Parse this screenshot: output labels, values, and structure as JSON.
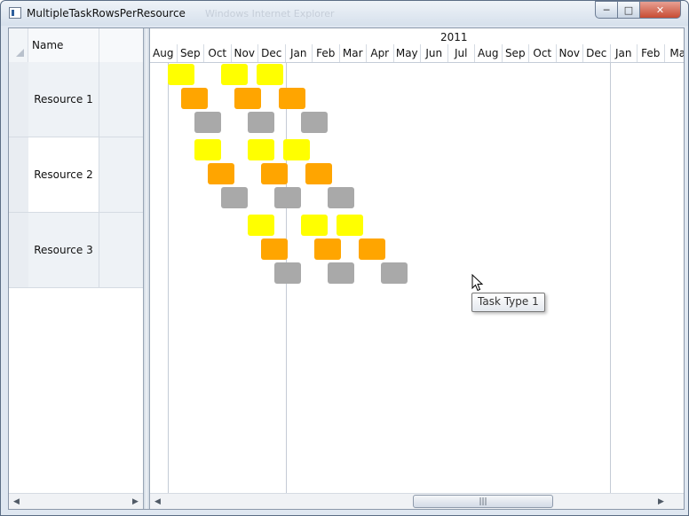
{
  "window": {
    "title": "MultipleTaskRowsPerResource",
    "ghost_title": "Windows Internet Explorer"
  },
  "grid": {
    "name_header": "Name",
    "rows": [
      {
        "name": "Resource 1"
      },
      {
        "name": "Resource 2"
      },
      {
        "name": "Resource 3"
      }
    ]
  },
  "timeline": {
    "year": "2011",
    "months": [
      "Aug",
      "Sep",
      "Oct",
      "Nov",
      "Dec",
      "Jan",
      "Feb",
      "Mar",
      "Apr",
      "May",
      "Jun",
      "Jul",
      "Aug",
      "Sep",
      "Oct",
      "Nov",
      "Dec",
      "Jan",
      "Feb",
      "Ma"
    ]
  },
  "task_colors": {
    "yellow": "#ffff00",
    "orange": "#ffa500",
    "gray": "#a9a9a9"
  },
  "tooltip": {
    "text": "Task Type 1"
  },
  "icons": {
    "minimize": "minimize-icon",
    "maximize": "maximize-icon",
    "close": "close-icon",
    "scroll_left": "scroll-left-icon",
    "scroll_right": "scroll-right-icon",
    "thumb_grip": "grip-icon"
  }
}
